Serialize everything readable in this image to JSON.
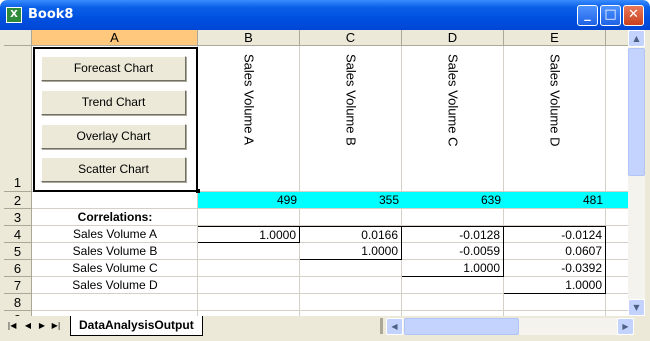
{
  "window": {
    "title": "Book8",
    "icon": "excel-icon",
    "minimize_glyph": "_",
    "maximize_glyph": "□",
    "close_glyph": "✕"
  },
  "grid": {
    "columns": [
      "A",
      "B",
      "C",
      "D",
      "E"
    ],
    "rows": [
      "1",
      "2",
      "3",
      "4",
      "5",
      "6",
      "7",
      "8",
      "9"
    ],
    "active_column": "A"
  },
  "buttons": {
    "forecast": "Forecast Chart",
    "trend": "Trend Chart",
    "overlay": "Overlay Chart",
    "scatter": "Scatter Chart"
  },
  "headers": [
    "Sales Volume A",
    "Sales Volume B",
    "Sales Volume C",
    "Sales Volume D"
  ],
  "row2": [
    "499",
    "355",
    "639",
    "481"
  ],
  "correlations": {
    "title": "Correlations:",
    "labels": [
      "Sales Volume A",
      "Sales Volume B",
      "Sales Volume C",
      "Sales Volume D"
    ],
    "matrix": [
      [
        "1.0000",
        "0.0166",
        "-0.0128",
        "-0.0124"
      ],
      [
        "",
        "1.0000",
        "-0.0059",
        "0.0607"
      ],
      [
        "",
        "",
        "1.0000",
        "-0.0392"
      ],
      [
        "",
        "",
        "",
        "1.0000"
      ]
    ]
  },
  "sheet_tab": "DataAnalysisOutput",
  "colors": {
    "title_bar": "#0054e3",
    "highlight_row": "#00ffff",
    "active_header": "#ffc87c"
  }
}
